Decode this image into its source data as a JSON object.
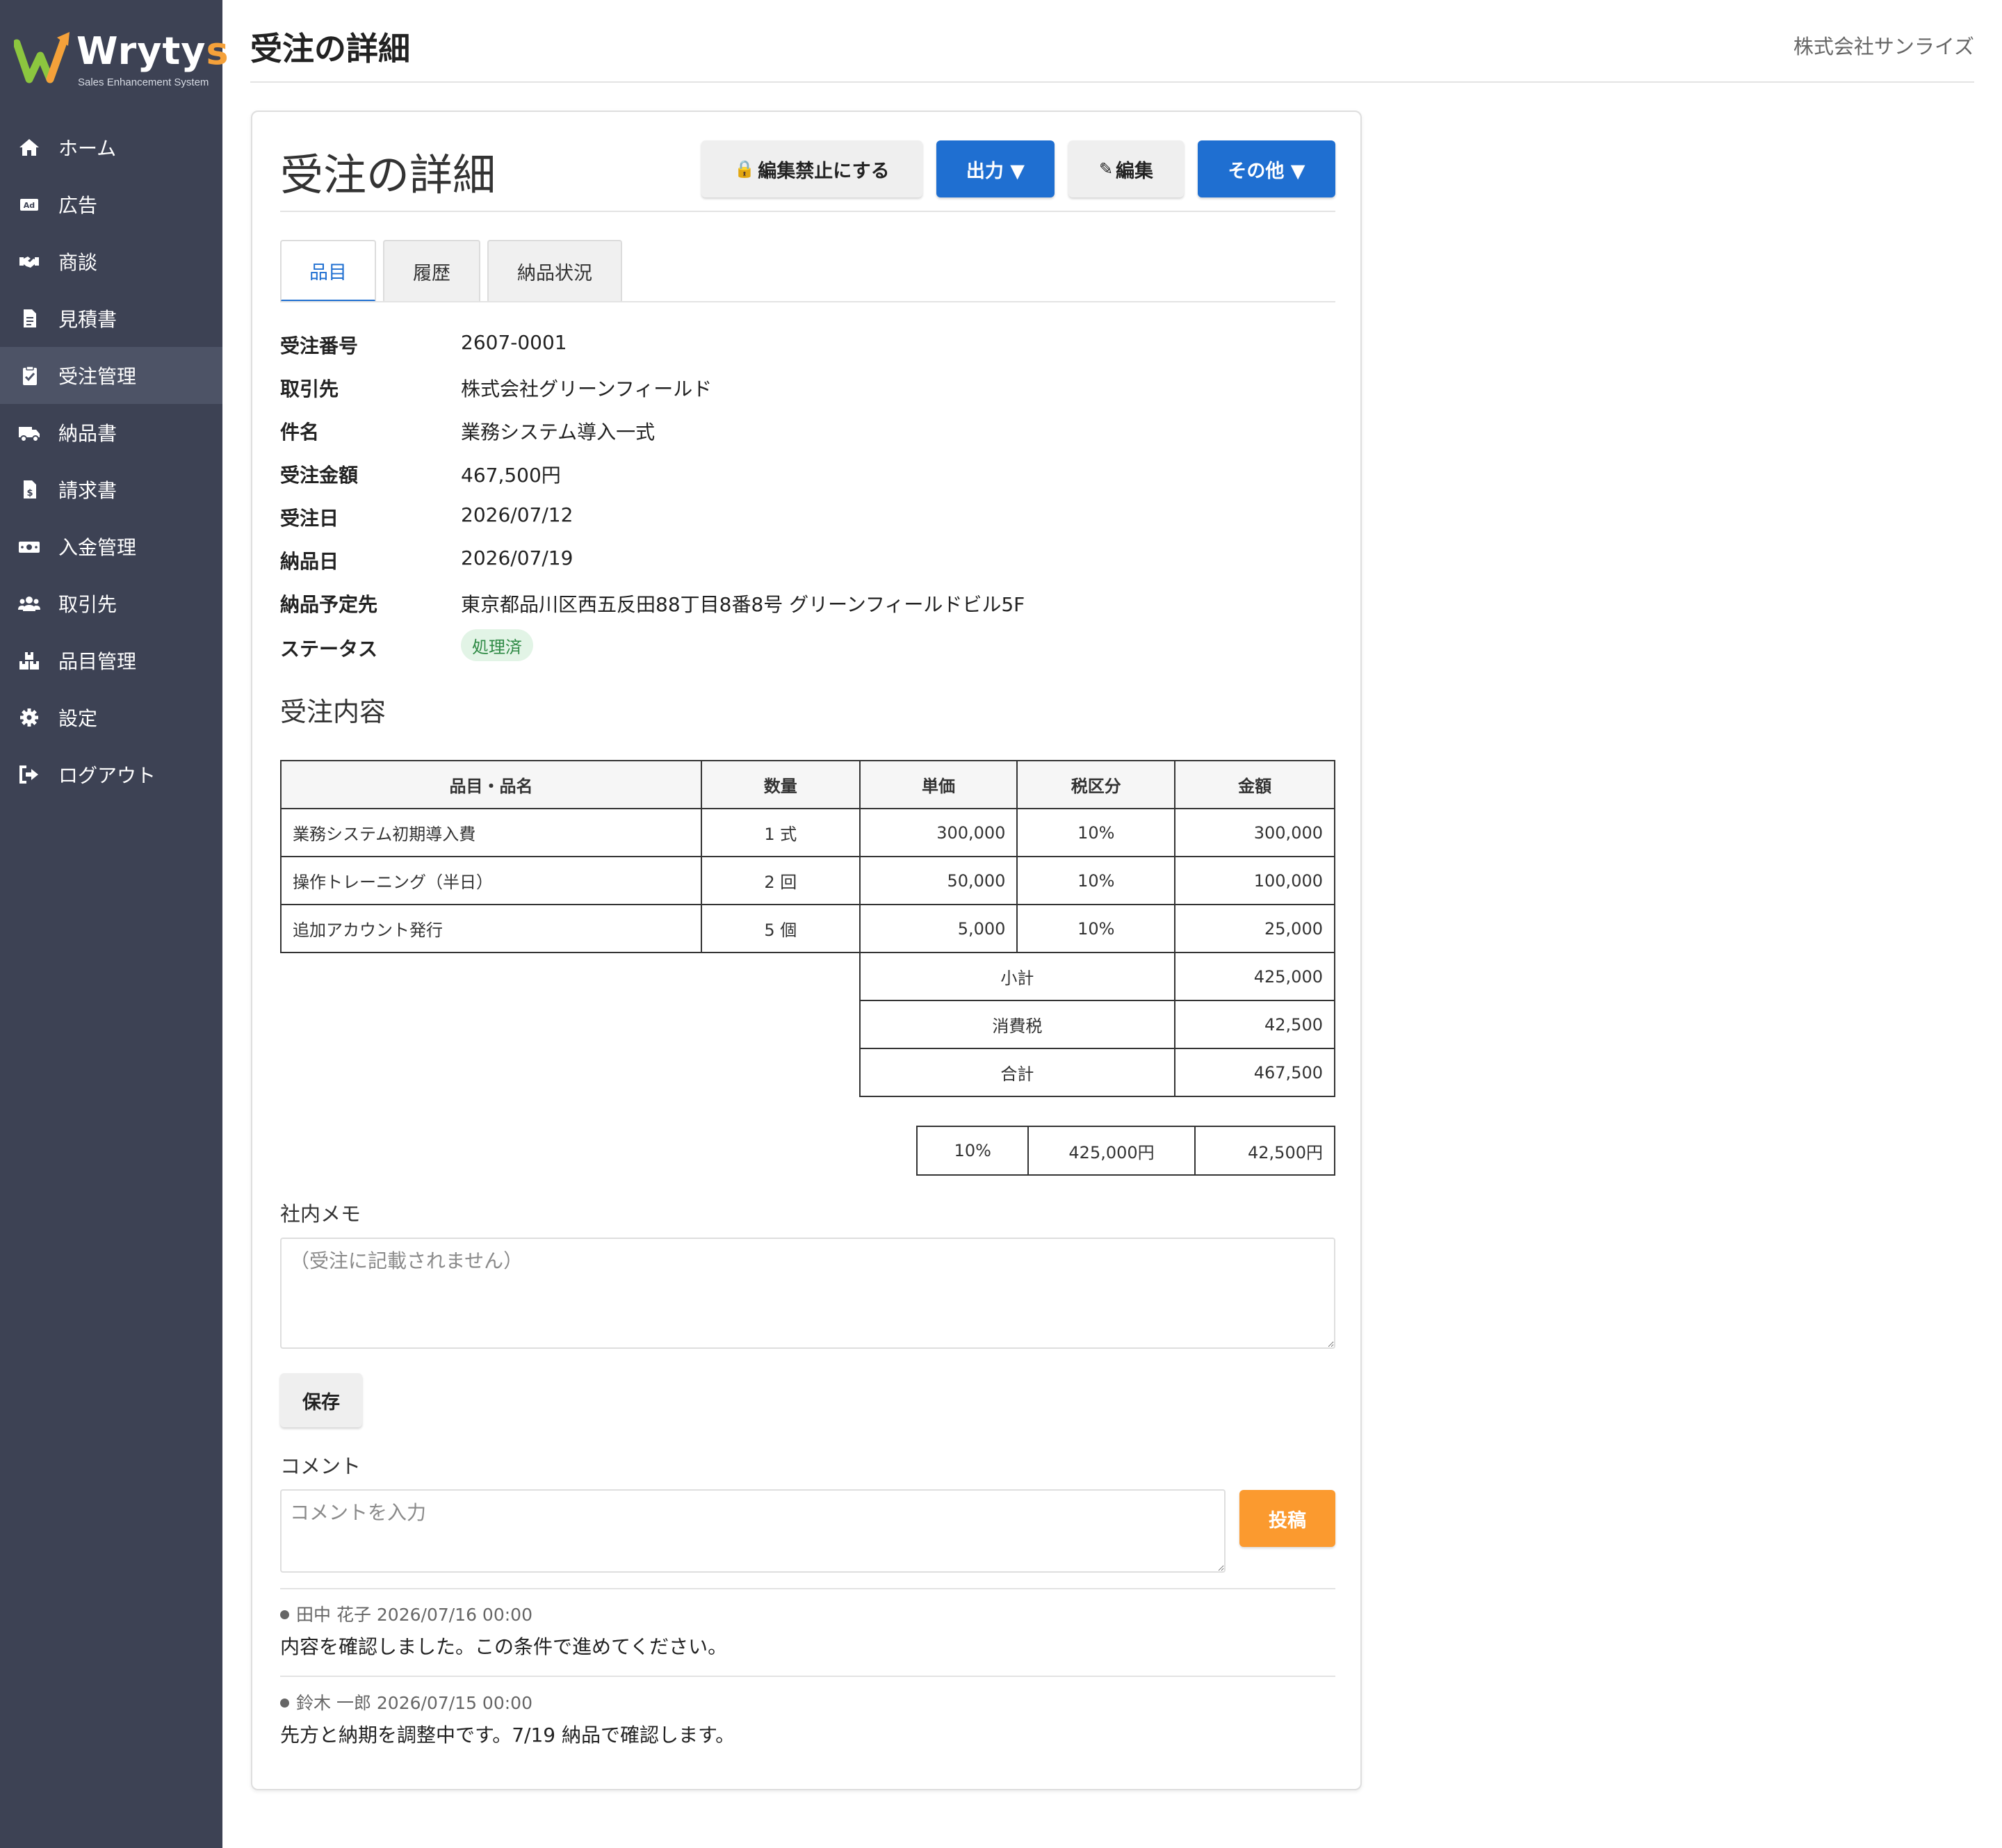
{
  "brand": {
    "name": "Wryty",
    "name_tail": "s",
    "tagline": "Sales Enhancement System"
  },
  "sidebar": {
    "items": [
      {
        "label": "ホーム",
        "icon": "home-icon"
      },
      {
        "label": "広告",
        "icon": "ad-icon"
      },
      {
        "label": "商談",
        "icon": "handshake-icon"
      },
      {
        "label": "見積書",
        "icon": "document-icon"
      },
      {
        "label": "受注管理",
        "icon": "clipboard-check-icon",
        "active": true
      },
      {
        "label": "納品書",
        "icon": "truck-icon"
      },
      {
        "label": "請求書",
        "icon": "invoice-icon"
      },
      {
        "label": "入金管理",
        "icon": "money-icon"
      },
      {
        "label": "取引先",
        "icon": "users-icon"
      },
      {
        "label": "品目管理",
        "icon": "boxes-icon"
      },
      {
        "label": "設定",
        "icon": "gear-icon"
      },
      {
        "label": "ログアウト",
        "icon": "logout-icon"
      }
    ]
  },
  "header": {
    "title": "受注の詳細",
    "company": "株式会社サンライズ"
  },
  "card": {
    "title": "受注の詳細",
    "buttons": {
      "lock": "編集禁止にする",
      "output": "出力 ▼",
      "edit": "編集",
      "more": "その他 ▼"
    },
    "tabs": [
      "品目",
      "履歴",
      "納品状況"
    ]
  },
  "info": [
    {
      "label": "受注番号",
      "value": "2607-0001"
    },
    {
      "label": "取引先",
      "value": "株式会社グリーンフィールド"
    },
    {
      "label": "件名",
      "value": "業務システム導入一式"
    },
    {
      "label": "受注金額",
      "value": "467,500円"
    },
    {
      "label": "受注日",
      "value": "2026/07/12"
    },
    {
      "label": "納品日",
      "value": "2026/07/19"
    },
    {
      "label": "納品予定先",
      "value": "東京都品川区西五反田88丁目8番8号 グリーンフィールドビル5F"
    },
    {
      "label": "ステータス",
      "value": "処理済"
    }
  ],
  "order_section": {
    "title": "受注内容",
    "columns": [
      "品目・品名",
      "数量",
      "単価",
      "税区分",
      "金額"
    ],
    "rows": [
      {
        "name": "業務システム初期導入費",
        "qty": "1 式",
        "price": "300,000",
        "tax": "10%",
        "amount": "300,000"
      },
      {
        "name": "操作トレーニング（半日）",
        "qty": "2 回",
        "price": "50,000",
        "tax": "10%",
        "amount": "100,000"
      },
      {
        "name": "追加アカウント発行",
        "qty": "5 個",
        "price": "5,000",
        "tax": "10%",
        "amount": "25,000"
      }
    ],
    "totals": [
      {
        "label": "小計",
        "value": "425,000"
      },
      {
        "label": "消費税",
        "value": "42,500"
      },
      {
        "label": "合計",
        "value": "467,500"
      }
    ],
    "tax_breakdown": {
      "rate": "10%",
      "base": "425,000円",
      "tax": "42,500円"
    }
  },
  "memo": {
    "label": "社内メモ",
    "placeholder": "（受注に記載されません）",
    "save_label": "保存"
  },
  "comments": {
    "label": "コメント",
    "placeholder": "コメントを入力",
    "post_label": "投稿",
    "items": [
      {
        "meta": "田中 花子 2026/07/16 00:00",
        "body": "内容を確認しました。この条件で進めてください。"
      },
      {
        "meta": "鈴木 一郎 2026/07/15 00:00",
        "body": "先方と納期を調整中です。7/19 納品で確認します。"
      }
    ]
  },
  "colors": {
    "sidebar": "#3d4254",
    "primary": "#1f6fd1",
    "accent": "#fb9a2f",
    "status_bg": "#e2f4e6",
    "status_fg": "#2f8a45"
  }
}
